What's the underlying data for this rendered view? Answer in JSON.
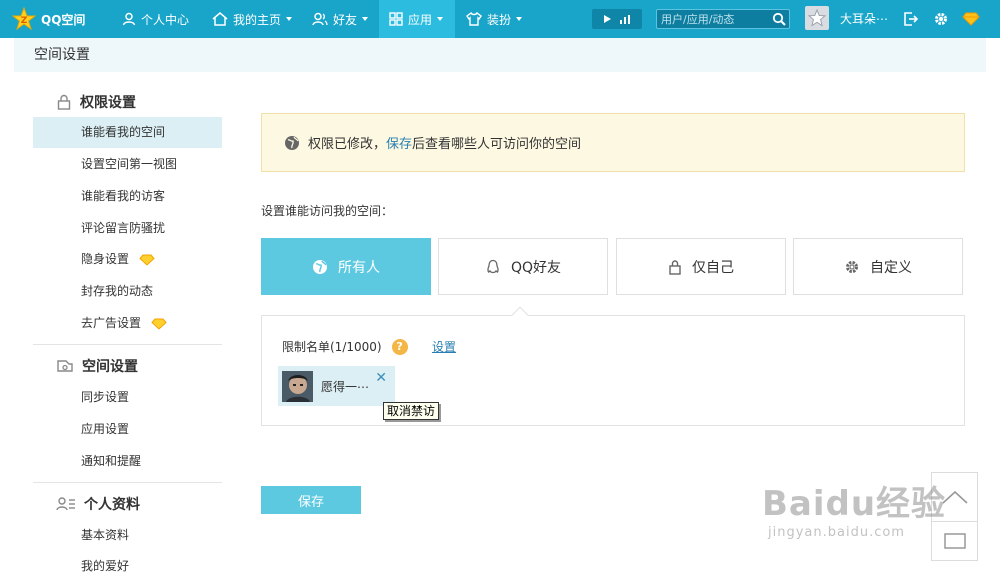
{
  "topbar": {
    "logo": "QQ空间",
    "nav": [
      {
        "label": "个人中心"
      },
      {
        "label": "我的主页"
      },
      {
        "label": "好友"
      },
      {
        "label": "应用"
      },
      {
        "label": "装扮"
      }
    ],
    "search_placeholder": "用户/应用/动态",
    "username": "大耳朵⋯"
  },
  "page_title": "空间设置",
  "sidebar": {
    "sections": [
      {
        "title": "权限设置",
        "items": [
          {
            "label": "谁能看我的空间"
          },
          {
            "label": "设置空间第一视图"
          },
          {
            "label": "谁能看我的访客"
          },
          {
            "label": "评论留言防骚扰"
          },
          {
            "label": "隐身设置"
          },
          {
            "label": "封存我的动态"
          },
          {
            "label": "去广告设置"
          }
        ]
      },
      {
        "title": "空间设置",
        "items": [
          {
            "label": "同步设置"
          },
          {
            "label": "应用设置"
          },
          {
            "label": "通知和提醒"
          }
        ]
      },
      {
        "title": "个人资料",
        "items": [
          {
            "label": "基本资料"
          },
          {
            "label": "我的爱好"
          }
        ]
      }
    ]
  },
  "notice": {
    "prefix": "权限已修改，",
    "link": "保存",
    "suffix": "后查看哪些人可访问你的空间"
  },
  "access_label": "设置谁能访问我的空间：",
  "options": [
    {
      "label": "所有人",
      "icon": "globe-icon",
      "selected": true
    },
    {
      "label": "QQ好友",
      "icon": "qq-penguin-icon",
      "selected": false
    },
    {
      "label": "仅自己",
      "icon": "lock-icon",
      "selected": false
    },
    {
      "label": "自定义",
      "icon": "gear-icon",
      "selected": false
    }
  ],
  "limit": {
    "title": "限制名单(1/1000)",
    "help": "?",
    "set_link": "设置",
    "blocked_user": "愿得一⋯",
    "remove_tooltip": "取消禁访"
  },
  "save_button": "保存",
  "watermark": {
    "line1": "Baidu经验",
    "line2": "jingyan.baidu.com"
  },
  "colors": {
    "topbar": "#19a5c9",
    "accent": "#5cc9e1",
    "link": "#2a7fb0",
    "notice_bg": "#fdf8e2"
  }
}
